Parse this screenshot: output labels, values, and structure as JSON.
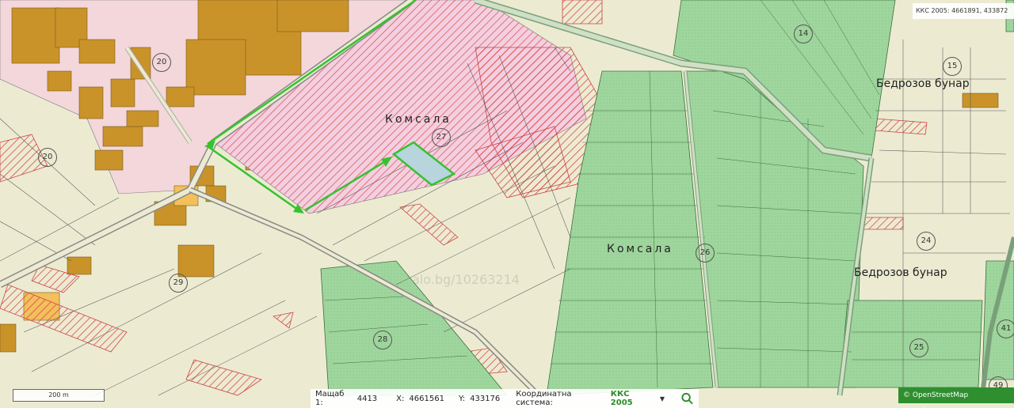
{
  "map": {
    "coord_readout": "ККС 2005: 4661891, 433872",
    "watermark": "alo.bg/10263214",
    "scale_label": "200 m",
    "area_labels": [
      "Комсала",
      "Комсала"
    ],
    "locality_labels": [
      "Бедрозов бунар",
      "Бедрозов бунар"
    ],
    "parcel_numbers": [
      "14",
      "15",
      "20",
      "27",
      "24",
      "28",
      "29",
      "41",
      "25",
      "49",
      "20",
      "26"
    ],
    "colors": {
      "background": "#ecebd2",
      "agricultural": "#9fd69d",
      "urban": "#f3d7db",
      "building": "#c9932a",
      "route": "#36c22f",
      "selected_parcel": "#b8d4dc",
      "hatch": "#d84b4b"
    }
  },
  "statusbar": {
    "scale_label": "Мащаб 1:",
    "scale_value": "4413",
    "x_label": "X:",
    "x_value": "4661561",
    "y_label": "Y:",
    "y_value": "433176",
    "system_label": "Координатна система:",
    "system_value": "ККС 2005",
    "search_icon": "search-icon"
  },
  "attribution": "© OpenStreetMap contributors."
}
